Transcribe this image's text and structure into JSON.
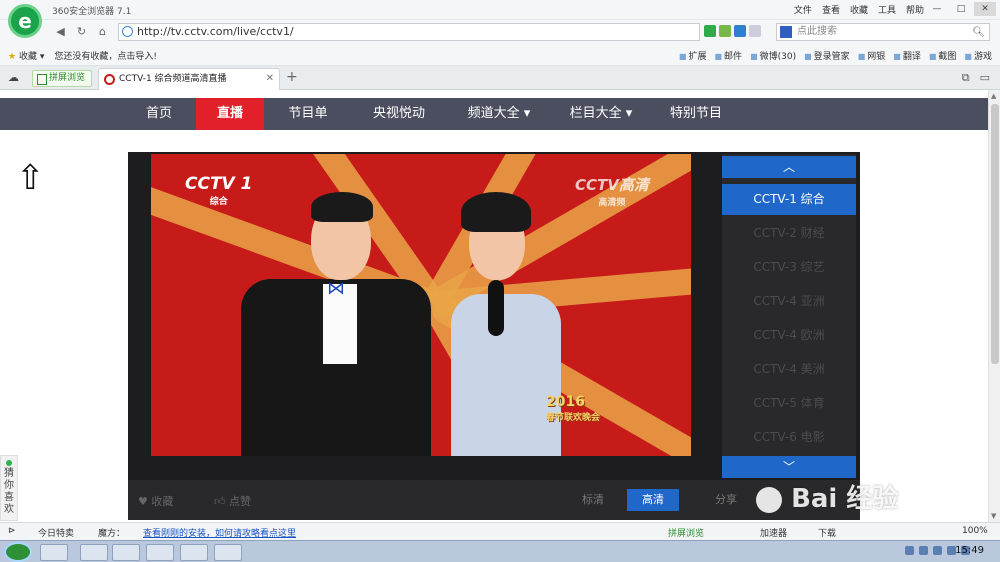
{
  "browser": {
    "window_title": "360安全浏览器 7.1",
    "title_menu": [
      "文件",
      "查看",
      "收藏",
      "工具",
      "帮助"
    ],
    "url": "http://tv.cctv.com/live/cctv1/",
    "search_placeholder": "点此搜索",
    "bookmarks_left": [
      "收藏",
      "您还没有收藏，点击导入!"
    ],
    "bookmarks_right": [
      "扩展",
      "邮件",
      "微博(30)",
      "登录管家",
      "网银",
      "翻译",
      "截图",
      "游戏"
    ],
    "tab_pill": "拼屏浏览",
    "active_tab": "CCTV-1 综合频道高清直播"
  },
  "site_nav": {
    "items": [
      "首页",
      "直播",
      "节目单",
      "央视悦动",
      "频道大全 ▾",
      "栏目大全 ▾",
      "特别节目"
    ]
  },
  "player": {
    "channel_logo": "CCTV 1",
    "channel_logo_sub": "综合",
    "hd_logo": "CCTV高清",
    "hd_logo_sub": "高清频",
    "gala_year": "2016",
    "gala_title": "春节联欢晚会",
    "like": "收藏",
    "thumbup": "点赞",
    "quality_sd": "标清",
    "quality_hd": "高清",
    "share": "分享",
    "channels": [
      "CCTV-1 综合",
      "CCTV-2 财经",
      "CCTV-3 综艺",
      "CCTV-4 亚洲",
      "CCTV-4 欧洲",
      "CCTV-4 美洲",
      "CCTV-5 体育",
      "CCTV-6 电影"
    ],
    "active_channel": "CCTV-1 综合"
  },
  "side_widget": "猜你喜欢",
  "watermark": "Bai 经验",
  "statusbar": {
    "left": "今日特卖",
    "middle_prefix": "魔方：",
    "link": "查看刚刚的安装，如何请攻略看点这里",
    "pinned": "拼屏浏览",
    "accel": "加速器",
    "download": "下载",
    "zoom": "100%"
  },
  "taskbar": {
    "clock": "15:49"
  }
}
